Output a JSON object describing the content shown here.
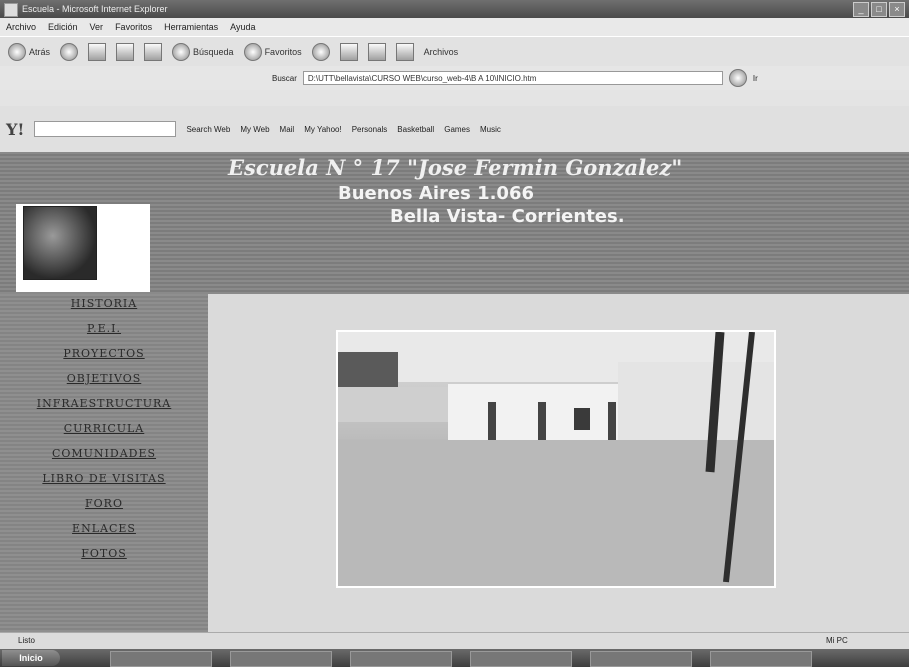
{
  "window": {
    "title": "Escuela - Microsoft Internet Explorer",
    "buttons": [
      "_",
      "□",
      "×"
    ]
  },
  "menu": [
    "Archivo",
    "Edición",
    "Ver",
    "Favoritos",
    "Herramientas",
    "Ayuda"
  ],
  "toolbar": {
    "back": "Atrás",
    "search": "Búsqueda",
    "favorites": "Favoritos",
    "files": "Archivos"
  },
  "address": {
    "label": "Buscar",
    "value": "D:\\UTT\\bellavista\\CURSO WEB\\curso_web-4\\B A 10\\INICIO.htm",
    "go": "Ir"
  },
  "yahoo": {
    "logo": "Y!",
    "items": [
      "Search Web",
      "My Web",
      "Mail",
      "My Yahoo!",
      "Personals",
      "Basketball",
      "Games",
      "Music"
    ]
  },
  "page": {
    "school_name": "Escuela N ° 17 \"Jose Fermin Gonzalez\"",
    "address": "Buenos Aires 1.066",
    "city": "Bella Vista- Corrientes.",
    "nav": [
      "HISTORIA",
      "P.E.I.",
      "PROYECTOS",
      "OBJETIVOS",
      "INFRAESTRUCTURA",
      "CURRICULA",
      "COMUNIDADES",
      "LIBRO DE VISITAS",
      "FORO",
      "ENLACES",
      "FOTOS"
    ]
  },
  "status": {
    "text": "Listo",
    "zone": "Mi PC"
  },
  "taskbar": {
    "start": "Inicio"
  }
}
